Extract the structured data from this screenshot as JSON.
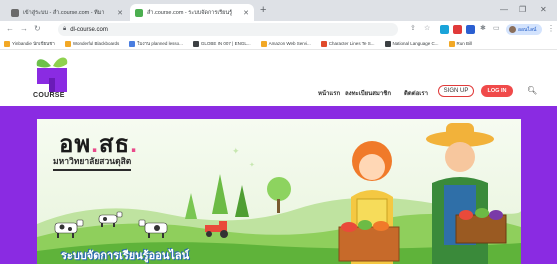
{
  "browser": {
    "tabs": [
      {
        "title": "เข้าสู่ระบบ - สำ.course.com - ที่มา",
        "active": false
      },
      {
        "title": "สำ.course.com - ระบบจัดการเรียนรู้",
        "active": true
      }
    ],
    "new_tab": "+",
    "address": "dl-course.com",
    "bookmarks": [
      {
        "label": "Yinbandie นักเขียนชา",
        "color": "#f2a825"
      },
      {
        "label": "Wonderful Blackboards",
        "color": "#f2a825"
      },
      {
        "label": "ใบงาน planned lesso...",
        "color": "#4a7ee0"
      },
      {
        "label": "GLOBE IN 007 | ENGL...",
        "color": "#3c4043"
      },
      {
        "label": "Amazon Web Servi...",
        "color": "#f2a825"
      },
      {
        "label": "Character Lines Te S...",
        "color": "#e04a2a"
      },
      {
        "label": "National Language C...",
        "color": "#3c4043"
      },
      {
        "label": "Run Bill",
        "color": "#f2a825"
      }
    ],
    "profile_label": "ออนไลน์"
  },
  "site": {
    "logo_text": "COURSE",
    "nav": [
      "หน้าแรก",
      "ลงทะเบียนสมาชิก",
      "ติดต่อเรา"
    ],
    "signup_label": "SIGN UP",
    "login_label": "LOG IN",
    "brand_color": "#8a2be2",
    "accent_color": "#f04a4a"
  },
  "hero": {
    "title_part1": "อพ",
    "title_dot": ".",
    "title_part2": "สธ",
    "title_dot2": ".",
    "subtitle": "มหาวิทยาลัยสวนดุสิต",
    "caption": "ระบบจัดการเรียนรู้ออนไลน์"
  }
}
